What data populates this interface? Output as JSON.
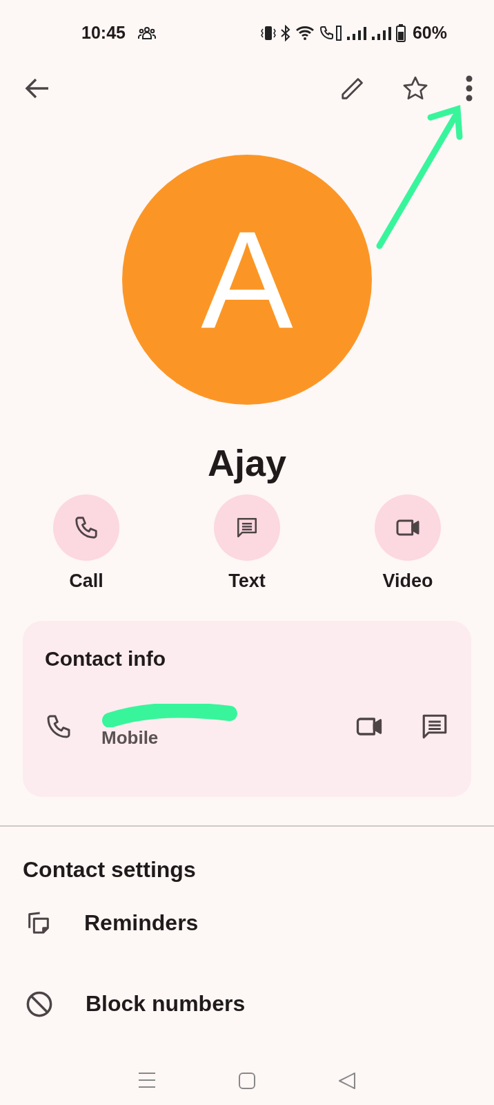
{
  "status_bar": {
    "time": "10:45",
    "battery": "60%"
  },
  "avatar": {
    "initial": "A"
  },
  "name": "Ajay",
  "actions": [
    {
      "label": "Call",
      "kind": "call"
    },
    {
      "label": "Text",
      "kind": "text"
    },
    {
      "label": "Video",
      "kind": "video"
    }
  ],
  "contact_info": {
    "title": "Contact info",
    "entries": [
      {
        "type": "Mobile"
      }
    ]
  },
  "contact_settings": {
    "title": "Contact settings",
    "items": [
      {
        "label": "Reminders",
        "kind": "reminders"
      },
      {
        "label": "Block numbers",
        "kind": "block"
      }
    ]
  }
}
